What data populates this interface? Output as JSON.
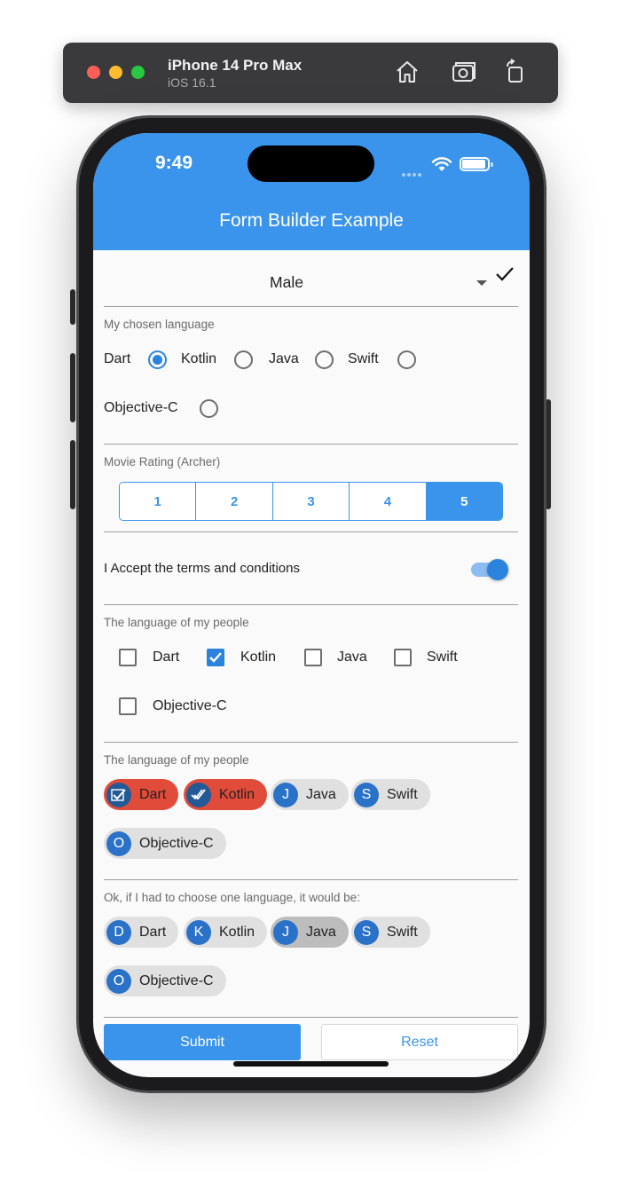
{
  "simulator": {
    "device_name": "iPhone 14 Pro Max",
    "os_version": "iOS 16.1"
  },
  "status_bar": {
    "time": "9:49"
  },
  "app_bar": {
    "title": "Form Builder Example"
  },
  "gender_dropdown": {
    "value": "Male"
  },
  "chosen_language": {
    "label": "My chosen language",
    "options": [
      "Dart",
      "Kotlin",
      "Java",
      "Swift",
      "Objective-C"
    ],
    "selected": "Dart"
  },
  "movie_rating": {
    "label": "Movie Rating (Archer)",
    "options": [
      "1",
      "2",
      "3",
      "4",
      "5"
    ],
    "selected": "5"
  },
  "terms": {
    "label": "I Accept the terms and conditions",
    "accepted": true
  },
  "people_language_checkboxes": {
    "label": "The language of my people",
    "options": [
      "Dart",
      "Kotlin",
      "Java",
      "Swift",
      "Objective-C"
    ],
    "checked": [
      "Kotlin"
    ]
  },
  "people_language_chips": {
    "label": "The language of my people",
    "chips": [
      {
        "avatar": "",
        "label": "Dart",
        "selected": true
      },
      {
        "avatar": "",
        "label": "Kotlin",
        "selected": true
      },
      {
        "avatar": "J",
        "label": "Java",
        "selected": false
      },
      {
        "avatar": "S",
        "label": "Swift",
        "selected": false
      },
      {
        "avatar": "O",
        "label": "Objective-C",
        "selected": false
      }
    ]
  },
  "one_language_chips": {
    "label": "Ok, if I had to choose one language, it would be:",
    "chips": [
      {
        "avatar": "D",
        "label": "Dart",
        "selected": false
      },
      {
        "avatar": "K",
        "label": "Kotlin",
        "selected": false
      },
      {
        "avatar": "J",
        "label": "Java",
        "selected": true
      },
      {
        "avatar": "S",
        "label": "Swift",
        "selected": false
      },
      {
        "avatar": "O",
        "label": "Objective-C",
        "selected": false
      }
    ]
  },
  "actions": {
    "submit_label": "Submit",
    "reset_label": "Reset"
  },
  "colors": {
    "primary": "#3a94ec",
    "chip_selected": "#e04b3a",
    "chip_default": "#e0e0e0",
    "avatar": "#2a72c8"
  }
}
